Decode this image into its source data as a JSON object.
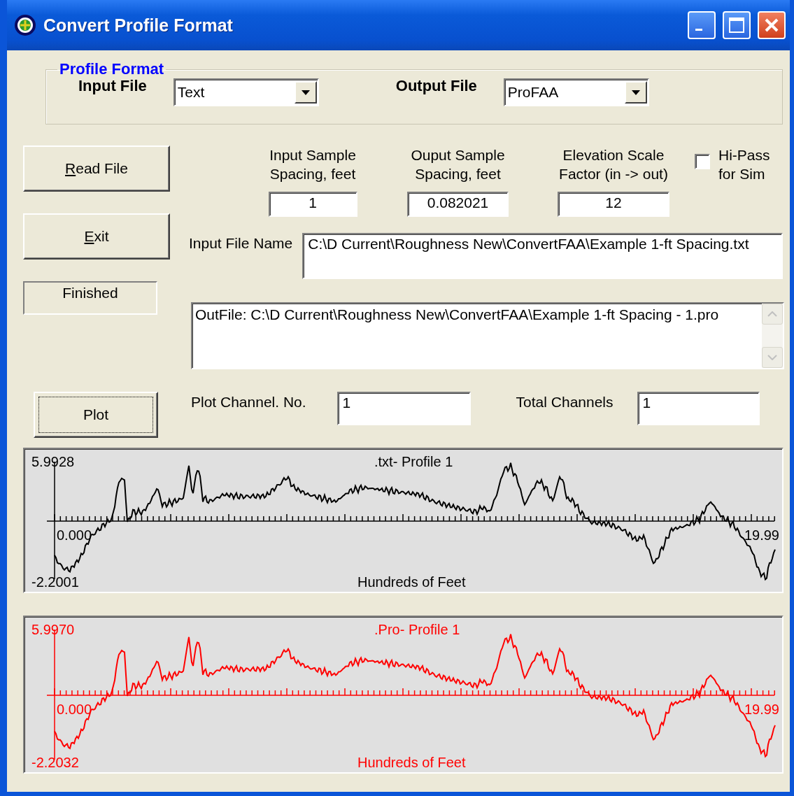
{
  "window": {
    "title": "Convert Profile Format"
  },
  "profile_format": {
    "legend": "Profile Format",
    "input_label": "Input File",
    "input_value": "Text",
    "output_label": "Output File",
    "output_value": "ProFAA"
  },
  "buttons": [
    {
      "label": "Read File",
      "underline_first": true
    },
    {
      "label": "Exit",
      "underline_first": true
    }
  ],
  "status": "Finished",
  "spacing_fields": [
    {
      "label": "Input Sample\nSpacing, feet",
      "value": "1"
    },
    {
      "label": "Ouput Sample\nSpacing, feet",
      "value": "0.082021"
    },
    {
      "label": "Elevation Scale\nFactor (in -> out)",
      "value": "12"
    }
  ],
  "hi_pass": {
    "label": "Hi-Pass\nfor Sim",
    "checked": false
  },
  "input_file_name": {
    "label": "Input File Name",
    "value": "C:\\D Current\\Roughness New\\ConvertFAA\\Example 1-ft Spacing.txt"
  },
  "output_log": "OutFile: C:\\D Current\\Roughness New\\ConvertFAA\\Example 1-ft Spacing - 1.pro",
  "plot_button": {
    "label": "Plot",
    "focused": true
  },
  "plot_channel": {
    "label": "Plot Channel. No.",
    "value": "1"
  },
  "total_channels": {
    "label": "Total Channels",
    "value": "1"
  },
  "plots": [
    {
      "title": ".txt- Profile 1",
      "y_max": "5.9928",
      "y_min": "-2.2001",
      "x_min": "0.000",
      "x_max": "19.99",
      "x_label": "Hundreds of Feet",
      "color": "#000000"
    },
    {
      "title": ".Pro- Profile 1",
      "y_max": "5.9970",
      "y_min": "-2.2032",
      "x_min": "0.000",
      "x_max": "19.99",
      "x_label": "Hundreds of Feet",
      "color": "#ff0000"
    }
  ]
}
